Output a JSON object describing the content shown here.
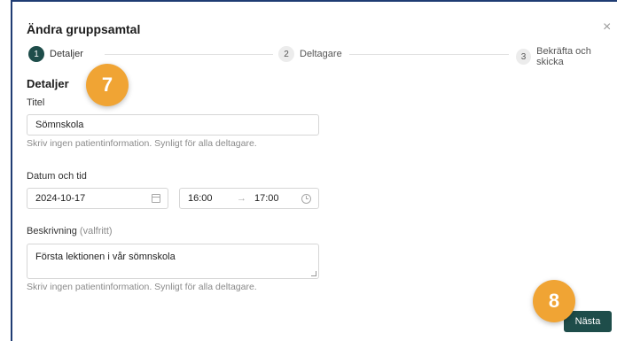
{
  "dialog": {
    "title": "Ändra gruppsamtal",
    "close_glyph": "×"
  },
  "steps": [
    {
      "number": "1",
      "label": "Detaljer",
      "active": true
    },
    {
      "number": "2",
      "label": "Deltagare",
      "active": false
    },
    {
      "number": "3",
      "label": "Bekräfta och skicka",
      "active": false
    }
  ],
  "annotations": {
    "badge_top": "7",
    "badge_bottom": "8"
  },
  "form": {
    "section_heading": "Detaljer",
    "title_field": {
      "label": "Titel",
      "value": "Sömnskola",
      "hint": "Skriv ingen patientinformation. Synligt för alla deltagare."
    },
    "datetime": {
      "label": "Datum och tid",
      "date": "2024-10-17",
      "start_time": "16:00",
      "separator": "→",
      "end_time": "17:00"
    },
    "description": {
      "label": "Beskrivning",
      "optional": "(valfritt)",
      "value": "Första lektionen i vår sömnskola",
      "hint": "Skriv ingen patientinformation. Synligt för alla deltagare."
    }
  },
  "footer": {
    "next_label": "Nästa"
  },
  "colors": {
    "primary": "#1e4d4a",
    "badge": "#f0a434",
    "frame": "#1f3c73"
  },
  "icons": [
    "close-icon",
    "calendar-icon",
    "clock-icon",
    "arrow-right-icon",
    "resize-handle-icon"
  ]
}
